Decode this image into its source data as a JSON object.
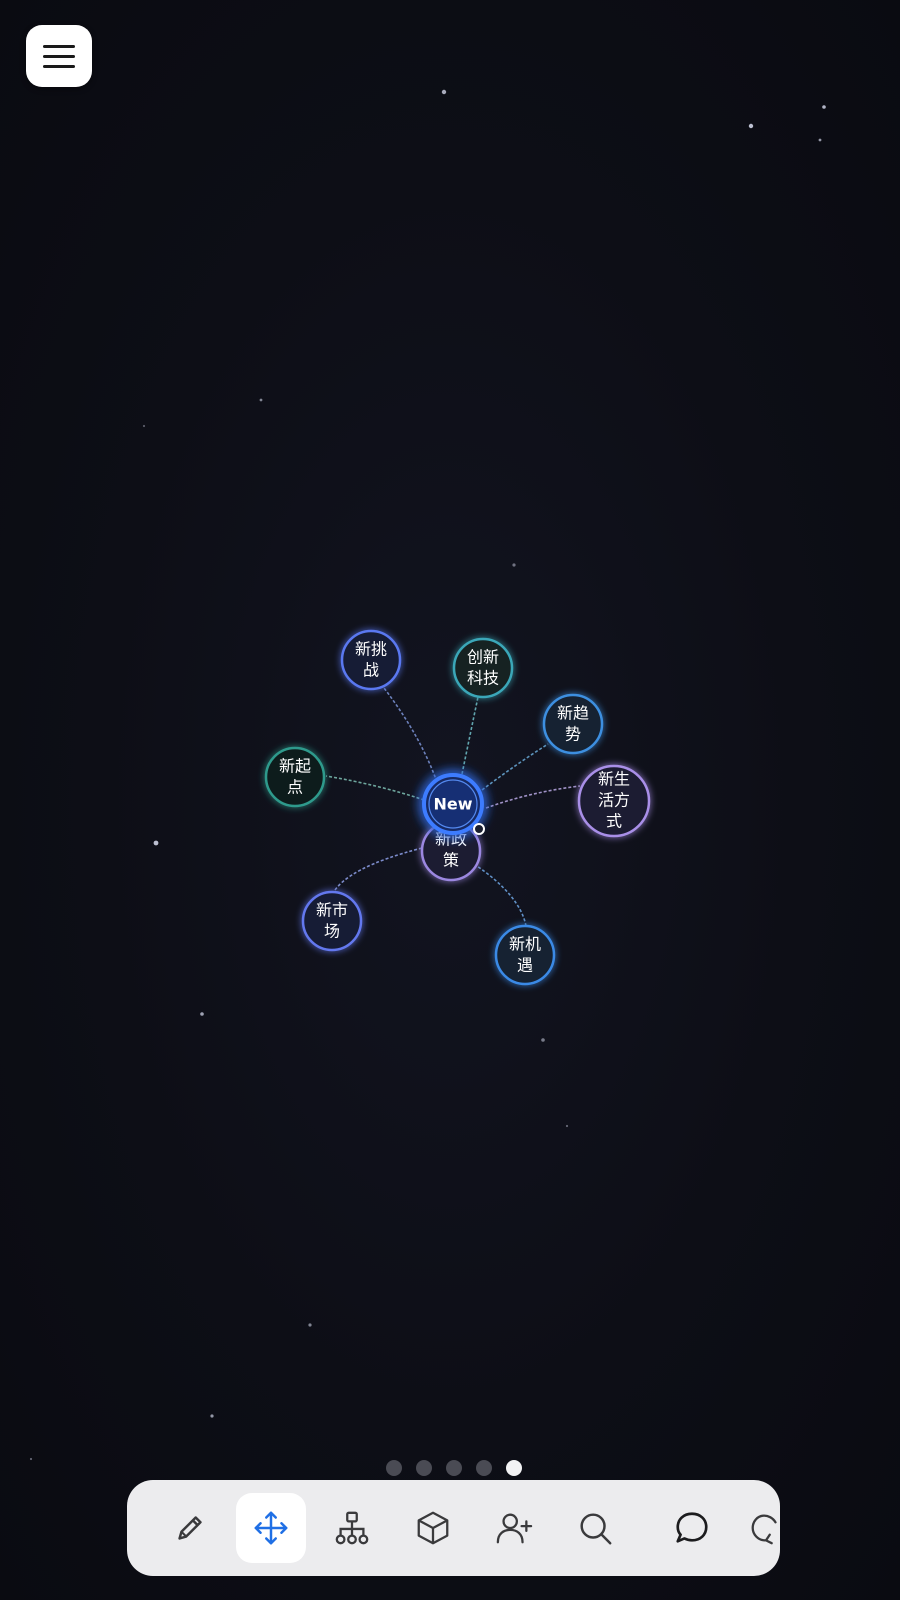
{
  "menu": {
    "icon": "hamburger-menu-icon"
  },
  "mindmap": {
    "center_label": "New",
    "nodes": [
      {
        "id": "tiaozhan",
        "lines": [
          "新挑",
          "战"
        ],
        "color": "#5a78f0"
      },
      {
        "id": "chuangxin",
        "lines": [
          "创新",
          "科技"
        ],
        "color": "#3aa7b8"
      },
      {
        "id": "qushi",
        "lines": [
          "新趋",
          "势"
        ],
        "color": "#3e8fe0"
      },
      {
        "id": "shenghuo",
        "lines": [
          "新生",
          "活方",
          "式"
        ],
        "color": "#a98fe8"
      },
      {
        "id": "qidian",
        "lines": [
          "新起",
          "点"
        ],
        "color": "#2f9a8c"
      },
      {
        "id": "zhengce",
        "lines": [
          "新政",
          "策"
        ],
        "color": "#9b87e0"
      },
      {
        "id": "shichang",
        "lines": [
          "新市",
          "场"
        ],
        "color": "#6478ee"
      },
      {
        "id": "jiyu",
        "lines": [
          "新机",
          "遇"
        ],
        "color": "#3b8ae6"
      }
    ]
  },
  "pager": {
    "count": 5,
    "active_index": 4
  },
  "toolbar": {
    "active_tool": "move",
    "tools": [
      "pencil-icon",
      "move-icon",
      "hierarchy-icon",
      "cube-icon",
      "add-user-icon",
      "search-icon",
      "chat-icon",
      "refresh-icon"
    ]
  }
}
